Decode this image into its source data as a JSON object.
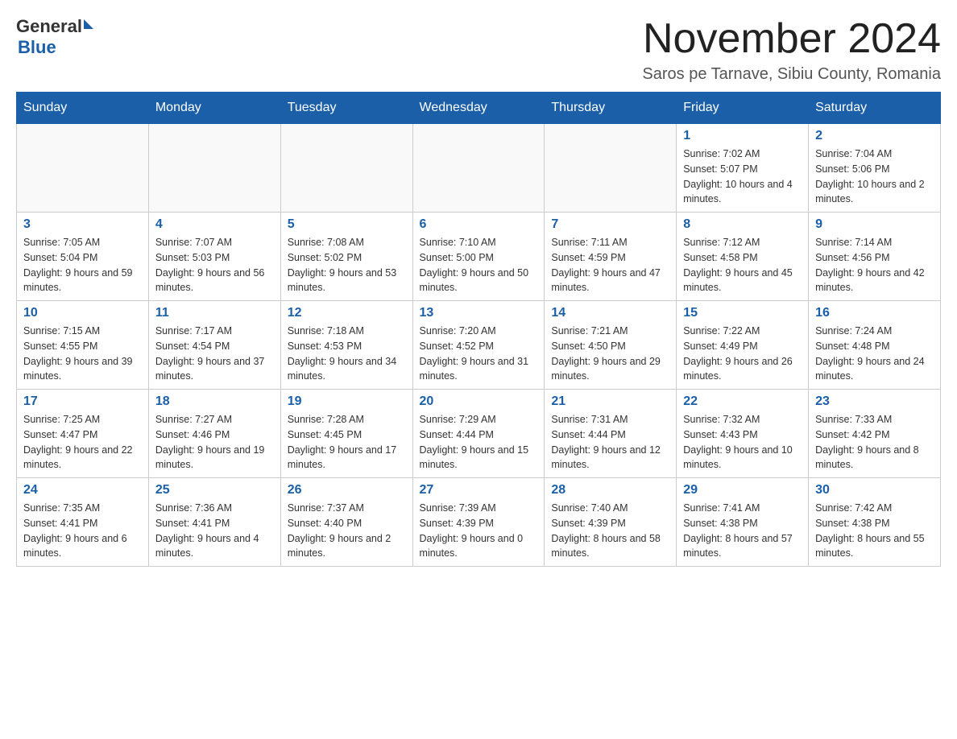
{
  "header": {
    "logo_general": "General",
    "logo_blue": "Blue",
    "title": "November 2024",
    "location": "Saros pe Tarnave, Sibiu County, Romania"
  },
  "weekdays": [
    "Sunday",
    "Monday",
    "Tuesday",
    "Wednesday",
    "Thursday",
    "Friday",
    "Saturday"
  ],
  "weeks": [
    [
      {
        "day": "",
        "sunrise": "",
        "sunset": "",
        "daylight": ""
      },
      {
        "day": "",
        "sunrise": "",
        "sunset": "",
        "daylight": ""
      },
      {
        "day": "",
        "sunrise": "",
        "sunset": "",
        "daylight": ""
      },
      {
        "day": "",
        "sunrise": "",
        "sunset": "",
        "daylight": ""
      },
      {
        "day": "",
        "sunrise": "",
        "sunset": "",
        "daylight": ""
      },
      {
        "day": "1",
        "sunrise": "Sunrise: 7:02 AM",
        "sunset": "Sunset: 5:07 PM",
        "daylight": "Daylight: 10 hours and 4 minutes."
      },
      {
        "day": "2",
        "sunrise": "Sunrise: 7:04 AM",
        "sunset": "Sunset: 5:06 PM",
        "daylight": "Daylight: 10 hours and 2 minutes."
      }
    ],
    [
      {
        "day": "3",
        "sunrise": "Sunrise: 7:05 AM",
        "sunset": "Sunset: 5:04 PM",
        "daylight": "Daylight: 9 hours and 59 minutes."
      },
      {
        "day": "4",
        "sunrise": "Sunrise: 7:07 AM",
        "sunset": "Sunset: 5:03 PM",
        "daylight": "Daylight: 9 hours and 56 minutes."
      },
      {
        "day": "5",
        "sunrise": "Sunrise: 7:08 AM",
        "sunset": "Sunset: 5:02 PM",
        "daylight": "Daylight: 9 hours and 53 minutes."
      },
      {
        "day": "6",
        "sunrise": "Sunrise: 7:10 AM",
        "sunset": "Sunset: 5:00 PM",
        "daylight": "Daylight: 9 hours and 50 minutes."
      },
      {
        "day": "7",
        "sunrise": "Sunrise: 7:11 AM",
        "sunset": "Sunset: 4:59 PM",
        "daylight": "Daylight: 9 hours and 47 minutes."
      },
      {
        "day": "8",
        "sunrise": "Sunrise: 7:12 AM",
        "sunset": "Sunset: 4:58 PM",
        "daylight": "Daylight: 9 hours and 45 minutes."
      },
      {
        "day": "9",
        "sunrise": "Sunrise: 7:14 AM",
        "sunset": "Sunset: 4:56 PM",
        "daylight": "Daylight: 9 hours and 42 minutes."
      }
    ],
    [
      {
        "day": "10",
        "sunrise": "Sunrise: 7:15 AM",
        "sunset": "Sunset: 4:55 PM",
        "daylight": "Daylight: 9 hours and 39 minutes."
      },
      {
        "day": "11",
        "sunrise": "Sunrise: 7:17 AM",
        "sunset": "Sunset: 4:54 PM",
        "daylight": "Daylight: 9 hours and 37 minutes."
      },
      {
        "day": "12",
        "sunrise": "Sunrise: 7:18 AM",
        "sunset": "Sunset: 4:53 PM",
        "daylight": "Daylight: 9 hours and 34 minutes."
      },
      {
        "day": "13",
        "sunrise": "Sunrise: 7:20 AM",
        "sunset": "Sunset: 4:52 PM",
        "daylight": "Daylight: 9 hours and 31 minutes."
      },
      {
        "day": "14",
        "sunrise": "Sunrise: 7:21 AM",
        "sunset": "Sunset: 4:50 PM",
        "daylight": "Daylight: 9 hours and 29 minutes."
      },
      {
        "day": "15",
        "sunrise": "Sunrise: 7:22 AM",
        "sunset": "Sunset: 4:49 PM",
        "daylight": "Daylight: 9 hours and 26 minutes."
      },
      {
        "day": "16",
        "sunrise": "Sunrise: 7:24 AM",
        "sunset": "Sunset: 4:48 PM",
        "daylight": "Daylight: 9 hours and 24 minutes."
      }
    ],
    [
      {
        "day": "17",
        "sunrise": "Sunrise: 7:25 AM",
        "sunset": "Sunset: 4:47 PM",
        "daylight": "Daylight: 9 hours and 22 minutes."
      },
      {
        "day": "18",
        "sunrise": "Sunrise: 7:27 AM",
        "sunset": "Sunset: 4:46 PM",
        "daylight": "Daylight: 9 hours and 19 minutes."
      },
      {
        "day": "19",
        "sunrise": "Sunrise: 7:28 AM",
        "sunset": "Sunset: 4:45 PM",
        "daylight": "Daylight: 9 hours and 17 minutes."
      },
      {
        "day": "20",
        "sunrise": "Sunrise: 7:29 AM",
        "sunset": "Sunset: 4:44 PM",
        "daylight": "Daylight: 9 hours and 15 minutes."
      },
      {
        "day": "21",
        "sunrise": "Sunrise: 7:31 AM",
        "sunset": "Sunset: 4:44 PM",
        "daylight": "Daylight: 9 hours and 12 minutes."
      },
      {
        "day": "22",
        "sunrise": "Sunrise: 7:32 AM",
        "sunset": "Sunset: 4:43 PM",
        "daylight": "Daylight: 9 hours and 10 minutes."
      },
      {
        "day": "23",
        "sunrise": "Sunrise: 7:33 AM",
        "sunset": "Sunset: 4:42 PM",
        "daylight": "Daylight: 9 hours and 8 minutes."
      }
    ],
    [
      {
        "day": "24",
        "sunrise": "Sunrise: 7:35 AM",
        "sunset": "Sunset: 4:41 PM",
        "daylight": "Daylight: 9 hours and 6 minutes."
      },
      {
        "day": "25",
        "sunrise": "Sunrise: 7:36 AM",
        "sunset": "Sunset: 4:41 PM",
        "daylight": "Daylight: 9 hours and 4 minutes."
      },
      {
        "day": "26",
        "sunrise": "Sunrise: 7:37 AM",
        "sunset": "Sunset: 4:40 PM",
        "daylight": "Daylight: 9 hours and 2 minutes."
      },
      {
        "day": "27",
        "sunrise": "Sunrise: 7:39 AM",
        "sunset": "Sunset: 4:39 PM",
        "daylight": "Daylight: 9 hours and 0 minutes."
      },
      {
        "day": "28",
        "sunrise": "Sunrise: 7:40 AM",
        "sunset": "Sunset: 4:39 PM",
        "daylight": "Daylight: 8 hours and 58 minutes."
      },
      {
        "day": "29",
        "sunrise": "Sunrise: 7:41 AM",
        "sunset": "Sunset: 4:38 PM",
        "daylight": "Daylight: 8 hours and 57 minutes."
      },
      {
        "day": "30",
        "sunrise": "Sunrise: 7:42 AM",
        "sunset": "Sunset: 4:38 PM",
        "daylight": "Daylight: 8 hours and 55 minutes."
      }
    ]
  ]
}
